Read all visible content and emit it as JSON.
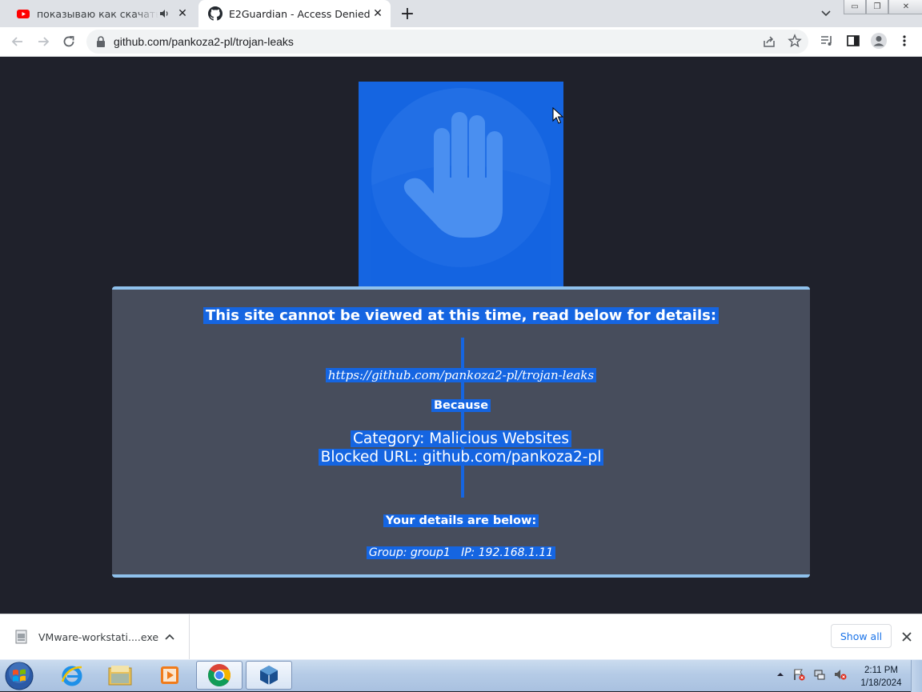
{
  "browser": {
    "tabs": [
      {
        "title": "показываю как скачать вир",
        "icon": "youtube-icon",
        "audio": true,
        "active": false
      },
      {
        "title": "E2Guardian - Access Denied",
        "icon": "github-icon",
        "active": true
      }
    ],
    "address": "github.com/pankoza2-pl/trojan-leaks"
  },
  "page": {
    "heading": "This site cannot be viewed at this time, read below for details:",
    "blocked_link": "https://github.com/pankoza2-pl/trojan-leaks",
    "because": "Because",
    "category": "Category: Malicious Websites",
    "blocked_url": "Blocked URL: github.com/pankoza2-pl",
    "details_heading": "Your details are below:",
    "details": "Group: group1   IP: 192.168.1.11",
    "colors": {
      "background": "#1f212b",
      "panel": "#474d5c",
      "selection": "#1565e1",
      "panel_border": "#8fc1ec"
    }
  },
  "downloads": {
    "file": "VMware-workstati....exe",
    "show_all": "Show all"
  },
  "taskbar": {
    "apps": [
      "start-orb",
      "internet-explorer",
      "file-explorer",
      "media-player",
      "chrome",
      "virtualbox"
    ],
    "time": "2:11 PM",
    "date": "1/18/2024"
  }
}
